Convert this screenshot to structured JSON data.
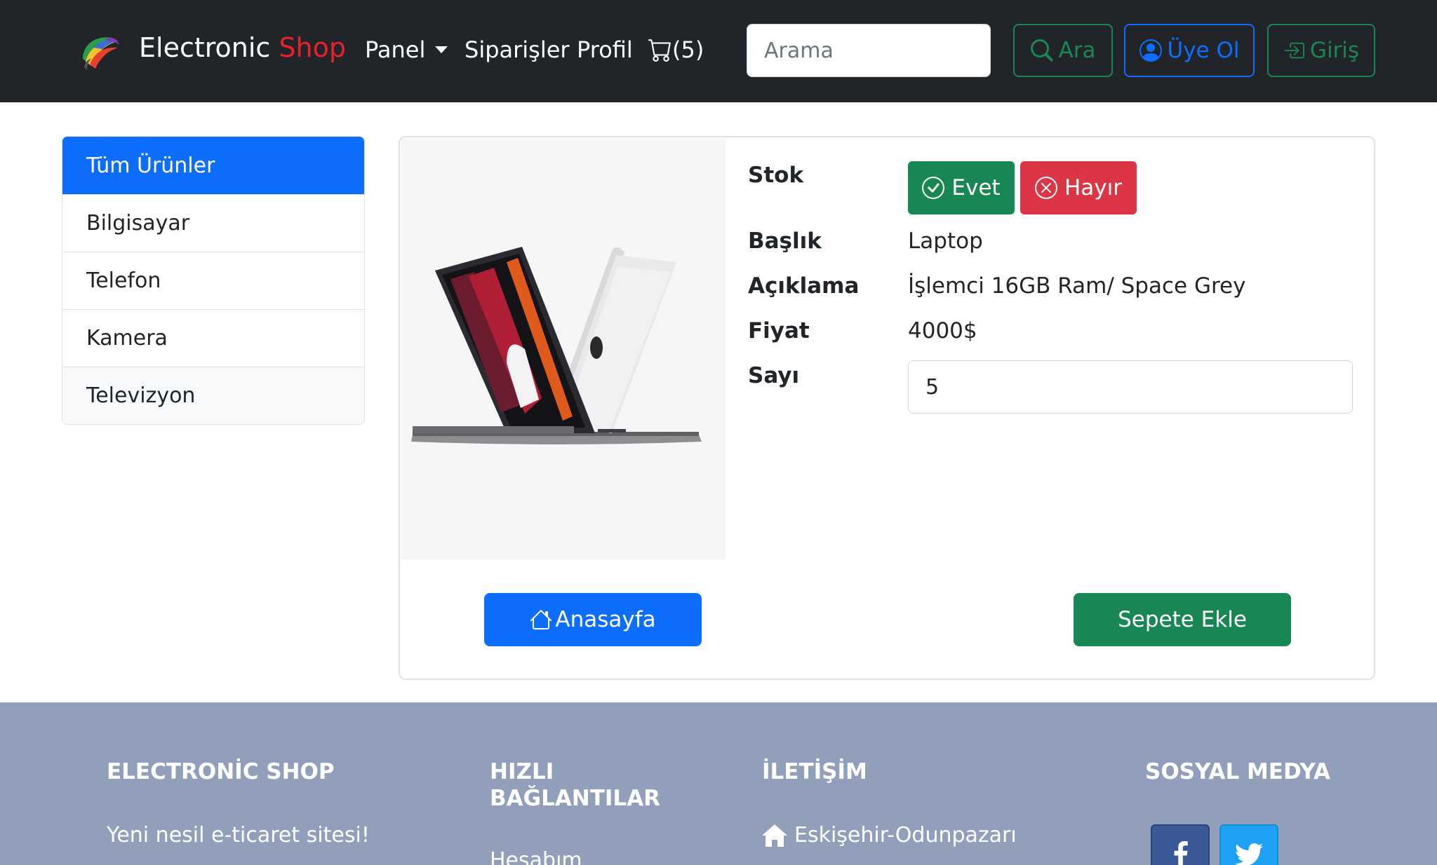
{
  "navbar": {
    "brand_main": "Electronic",
    "brand_accent": "Shop",
    "links": {
      "panel": "Panel",
      "orders": "Siparişler",
      "profile": "Profil",
      "cart_count": "(5)"
    },
    "search_placeholder": "Arama",
    "search_button": "Ara",
    "register_button": "Üye Ol",
    "login_button": "Giriş"
  },
  "sidebar": {
    "items": [
      {
        "label": "Tüm Ürünler",
        "active": true
      },
      {
        "label": "Bilgisayar"
      },
      {
        "label": "Telefon"
      },
      {
        "label": "Kamera"
      },
      {
        "label": "Televizyon"
      }
    ]
  },
  "product": {
    "stock_label": "Stok",
    "stock_yes": "Evet",
    "stock_no": "Hayır",
    "title_label": "Başlık",
    "title_value": "Laptop",
    "description_label": "Açıklama",
    "description_value": "İşlemci 16GB Ram/ Space Grey",
    "price_label": "Fiyat",
    "price_value": "4000$",
    "quantity_label": "Sayı",
    "quantity_value": "5",
    "home_button": "Anasayfa",
    "add_to_cart_button": "Sepete Ekle"
  },
  "footer": {
    "about_heading": "ELECTRONİC SHOP",
    "about_text": "Yeni nesil e-ticaret sitesi!",
    "links_heading_line1": "HIZLI",
    "links_heading_line2": "BAĞLANTILAR",
    "links_first": "Hesabım",
    "contact_heading": "İLETİŞİM",
    "contact_address": "Eskişehir-Odunpazarı",
    "social_heading": "SOSYAL MEDYA"
  },
  "colors": {
    "navbar_bg": "#212529",
    "brand_accent": "#e8212b",
    "primary": "#0d6efd",
    "success": "#198754",
    "danger": "#dc3545",
    "footer_bg": "#919fba",
    "facebook": "#3b5998",
    "twitter": "#1da1f2"
  }
}
